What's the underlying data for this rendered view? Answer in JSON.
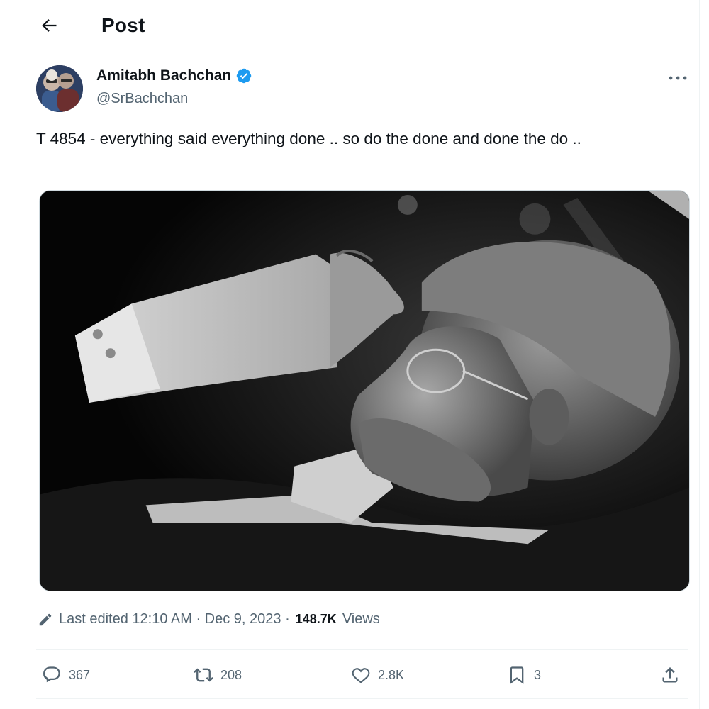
{
  "header": {
    "title": "Post",
    "back_icon": "arrow-left-icon"
  },
  "author": {
    "display_name": "Amitabh Bachchan",
    "handle": "@SrBachchan",
    "verified": true,
    "verified_color": "#1d9bf0"
  },
  "post": {
    "text": "T 4854 - everything said everything done .. so do the done and done the do ..",
    "media_alt": "Black and white photo of a man with glasses shielding his eyes with his hand"
  },
  "meta": {
    "edited_label": "Last edited 12:10 AM · Dec 9, 2023 ·",
    "views_count": "148.7K",
    "views_label": "Views",
    "edit_icon": "pencil-icon"
  },
  "actions": {
    "replies": "367",
    "reposts": "208",
    "likes": "2.8K",
    "bookmarks": "3"
  },
  "colors": {
    "text_primary": "#0f1419",
    "text_secondary": "#536471",
    "divider": "#eff3f4"
  }
}
